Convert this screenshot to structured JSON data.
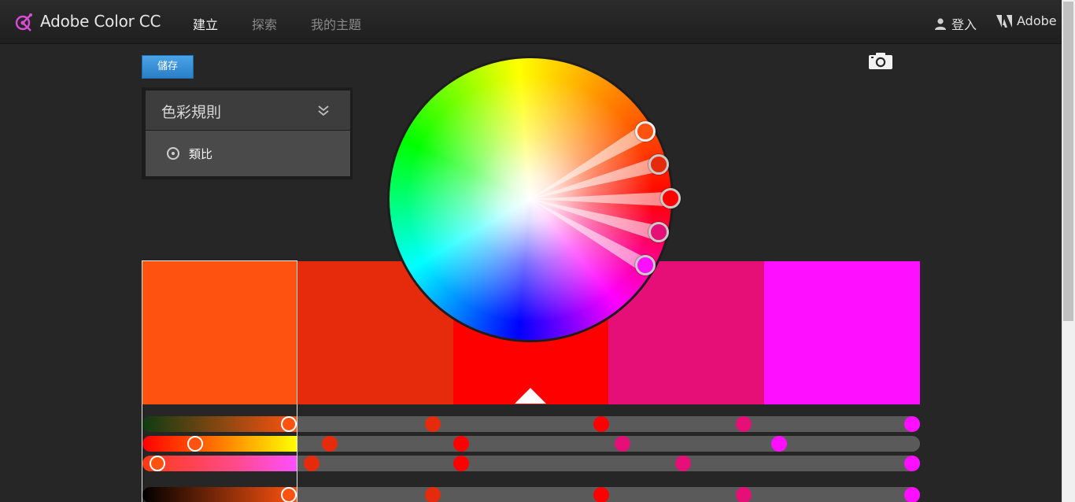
{
  "header": {
    "brand": "Adobe Color CC",
    "nav": [
      "建立",
      "探索",
      "我的主題"
    ],
    "login": "登入",
    "adobe": "Adobe"
  },
  "toolbar": {
    "save_label": "儲存"
  },
  "rules": {
    "title": "色彩規則",
    "selected": "類比"
  },
  "colors": {
    "swatches": [
      "#fe5310",
      "#e62b0c",
      "#ff0000",
      "#e60f77",
      "#ff0fff"
    ],
    "selected_index": 0,
    "accent": "#2a7fc6"
  },
  "icons": {
    "logo": "adobe-color-logo-icon",
    "user": "user-icon",
    "adobe": "adobe-logo-icon",
    "chevron": "double-chevron-down-icon",
    "camera": "camera-icon",
    "radio": "radio-icon"
  }
}
